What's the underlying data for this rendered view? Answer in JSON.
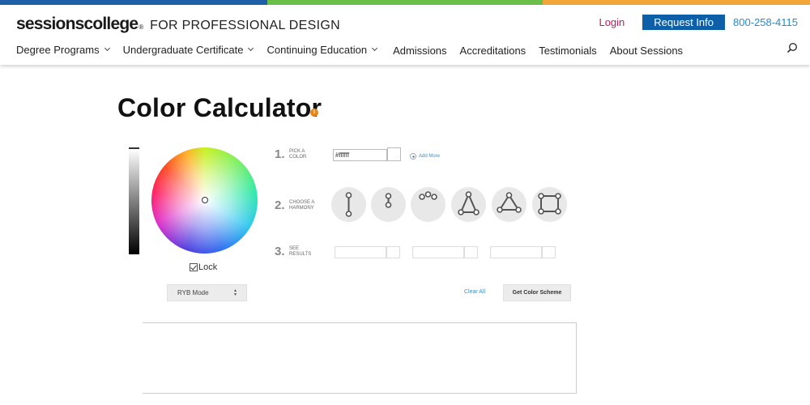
{
  "brand": {
    "name": "sessionscollege",
    "registered": "®",
    "tagline": "FOR PROFESSIONAL DESIGN"
  },
  "stripe_colors": [
    "#1f5fa8",
    "#6abf4b",
    "#f2a63a"
  ],
  "utility": {
    "login": "Login",
    "request_info": "Request Info",
    "phone": "800-258-4115"
  },
  "nav": {
    "items": [
      {
        "label": "Degree Programs",
        "has_dropdown": true
      },
      {
        "label": "Undergraduate Certificate",
        "has_dropdown": true
      },
      {
        "label": "Continuing Education",
        "has_dropdown": true
      },
      {
        "label": "Admissions",
        "has_dropdown": false
      },
      {
        "label": "Accreditations",
        "has_dropdown": false
      },
      {
        "label": "Testimonials",
        "has_dropdown": false
      },
      {
        "label": "About Sessions",
        "has_dropdown": false
      }
    ],
    "search_icon": "search-icon"
  },
  "page": {
    "title": "Color Calculator",
    "info_icon_label": "i"
  },
  "picker": {
    "lock_label": "Lock",
    "lock_checked": true,
    "mode": "RYB Mode",
    "mode_arrows": "▲▼"
  },
  "steps": [
    {
      "number": "1.",
      "label": "PICK A COLOR"
    },
    {
      "number": "2.",
      "label": "CHOOSE A HARMONY"
    },
    {
      "number": "3.",
      "label": "SEE RESULTS"
    }
  ],
  "color_input": {
    "value": "#ffffff",
    "add_more": "Add More"
  },
  "harmonies": [
    "monochromatic",
    "complementary",
    "analogous",
    "split-complementary",
    "triadic",
    "tetradic"
  ],
  "actions": {
    "clear_all": "Clear All",
    "get_scheme": "Get Color Scheme"
  },
  "colors": {
    "accent_blue": "#0d5fa8",
    "link_blue": "#2a8ad0",
    "login_pink": "#c2185b",
    "info_orange": "#e8861a"
  }
}
